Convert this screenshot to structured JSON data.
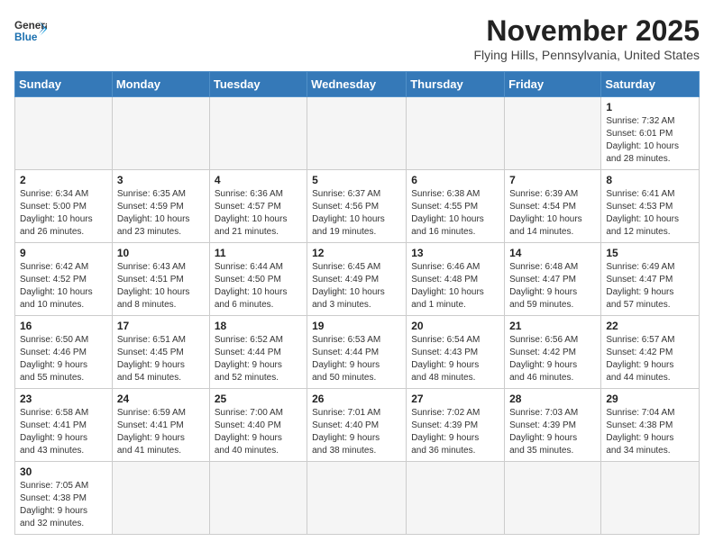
{
  "header": {
    "logo_line1": "General",
    "logo_line2": "Blue",
    "title": "November 2025",
    "subtitle": "Flying Hills, Pennsylvania, United States"
  },
  "days_of_week": [
    "Sunday",
    "Monday",
    "Tuesday",
    "Wednesday",
    "Thursday",
    "Friday",
    "Saturday"
  ],
  "weeks": [
    [
      {
        "day": "",
        "info": ""
      },
      {
        "day": "",
        "info": ""
      },
      {
        "day": "",
        "info": ""
      },
      {
        "day": "",
        "info": ""
      },
      {
        "day": "",
        "info": ""
      },
      {
        "day": "",
        "info": ""
      },
      {
        "day": "1",
        "info": "Sunrise: 7:32 AM\nSunset: 6:01 PM\nDaylight: 10 hours\nand 28 minutes."
      }
    ],
    [
      {
        "day": "2",
        "info": "Sunrise: 6:34 AM\nSunset: 5:00 PM\nDaylight: 10 hours\nand 26 minutes."
      },
      {
        "day": "3",
        "info": "Sunrise: 6:35 AM\nSunset: 4:59 PM\nDaylight: 10 hours\nand 23 minutes."
      },
      {
        "day": "4",
        "info": "Sunrise: 6:36 AM\nSunset: 4:57 PM\nDaylight: 10 hours\nand 21 minutes."
      },
      {
        "day": "5",
        "info": "Sunrise: 6:37 AM\nSunset: 4:56 PM\nDaylight: 10 hours\nand 19 minutes."
      },
      {
        "day": "6",
        "info": "Sunrise: 6:38 AM\nSunset: 4:55 PM\nDaylight: 10 hours\nand 16 minutes."
      },
      {
        "day": "7",
        "info": "Sunrise: 6:39 AM\nSunset: 4:54 PM\nDaylight: 10 hours\nand 14 minutes."
      },
      {
        "day": "8",
        "info": "Sunrise: 6:41 AM\nSunset: 4:53 PM\nDaylight: 10 hours\nand 12 minutes."
      }
    ],
    [
      {
        "day": "9",
        "info": "Sunrise: 6:42 AM\nSunset: 4:52 PM\nDaylight: 10 hours\nand 10 minutes."
      },
      {
        "day": "10",
        "info": "Sunrise: 6:43 AM\nSunset: 4:51 PM\nDaylight: 10 hours\nand 8 minutes."
      },
      {
        "day": "11",
        "info": "Sunrise: 6:44 AM\nSunset: 4:50 PM\nDaylight: 10 hours\nand 6 minutes."
      },
      {
        "day": "12",
        "info": "Sunrise: 6:45 AM\nSunset: 4:49 PM\nDaylight: 10 hours\nand 3 minutes."
      },
      {
        "day": "13",
        "info": "Sunrise: 6:46 AM\nSunset: 4:48 PM\nDaylight: 10 hours\nand 1 minute."
      },
      {
        "day": "14",
        "info": "Sunrise: 6:48 AM\nSunset: 4:47 PM\nDaylight: 9 hours\nand 59 minutes."
      },
      {
        "day": "15",
        "info": "Sunrise: 6:49 AM\nSunset: 4:47 PM\nDaylight: 9 hours\nand 57 minutes."
      }
    ],
    [
      {
        "day": "16",
        "info": "Sunrise: 6:50 AM\nSunset: 4:46 PM\nDaylight: 9 hours\nand 55 minutes."
      },
      {
        "day": "17",
        "info": "Sunrise: 6:51 AM\nSunset: 4:45 PM\nDaylight: 9 hours\nand 54 minutes."
      },
      {
        "day": "18",
        "info": "Sunrise: 6:52 AM\nSunset: 4:44 PM\nDaylight: 9 hours\nand 52 minutes."
      },
      {
        "day": "19",
        "info": "Sunrise: 6:53 AM\nSunset: 4:44 PM\nDaylight: 9 hours\nand 50 minutes."
      },
      {
        "day": "20",
        "info": "Sunrise: 6:54 AM\nSunset: 4:43 PM\nDaylight: 9 hours\nand 48 minutes."
      },
      {
        "day": "21",
        "info": "Sunrise: 6:56 AM\nSunset: 4:42 PM\nDaylight: 9 hours\nand 46 minutes."
      },
      {
        "day": "22",
        "info": "Sunrise: 6:57 AM\nSunset: 4:42 PM\nDaylight: 9 hours\nand 44 minutes."
      }
    ],
    [
      {
        "day": "23",
        "info": "Sunrise: 6:58 AM\nSunset: 4:41 PM\nDaylight: 9 hours\nand 43 minutes."
      },
      {
        "day": "24",
        "info": "Sunrise: 6:59 AM\nSunset: 4:41 PM\nDaylight: 9 hours\nand 41 minutes."
      },
      {
        "day": "25",
        "info": "Sunrise: 7:00 AM\nSunset: 4:40 PM\nDaylight: 9 hours\nand 40 minutes."
      },
      {
        "day": "26",
        "info": "Sunrise: 7:01 AM\nSunset: 4:40 PM\nDaylight: 9 hours\nand 38 minutes."
      },
      {
        "day": "27",
        "info": "Sunrise: 7:02 AM\nSunset: 4:39 PM\nDaylight: 9 hours\nand 36 minutes."
      },
      {
        "day": "28",
        "info": "Sunrise: 7:03 AM\nSunset: 4:39 PM\nDaylight: 9 hours\nand 35 minutes."
      },
      {
        "day": "29",
        "info": "Sunrise: 7:04 AM\nSunset: 4:38 PM\nDaylight: 9 hours\nand 34 minutes."
      }
    ],
    [
      {
        "day": "30",
        "info": "Sunrise: 7:05 AM\nSunset: 4:38 PM\nDaylight: 9 hours\nand 32 minutes."
      },
      {
        "day": "",
        "info": ""
      },
      {
        "day": "",
        "info": ""
      },
      {
        "day": "",
        "info": ""
      },
      {
        "day": "",
        "info": ""
      },
      {
        "day": "",
        "info": ""
      },
      {
        "day": "",
        "info": ""
      }
    ]
  ]
}
